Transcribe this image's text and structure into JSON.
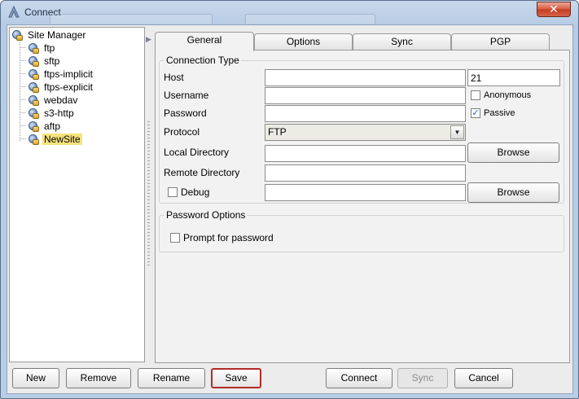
{
  "window": {
    "title": "Connect",
    "close_label": "✕"
  },
  "tree": {
    "root_label": "Site Manager",
    "items": [
      {
        "label": "ftp",
        "selected": false
      },
      {
        "label": "sftp",
        "selected": false
      },
      {
        "label": "ftps-implicit",
        "selected": false
      },
      {
        "label": "ftps-explicit",
        "selected": false
      },
      {
        "label": "webdav",
        "selected": false
      },
      {
        "label": "s3-http",
        "selected": false
      },
      {
        "label": "aftp",
        "selected": false
      },
      {
        "label": "NewSite",
        "selected": true
      }
    ]
  },
  "tabs": {
    "general": "General",
    "options": "Options",
    "sync": "Sync",
    "pgp": "PGP",
    "active": "General"
  },
  "connection": {
    "group_label": "Connection Type",
    "host_label": "Host",
    "host_value": "",
    "port_value": "21",
    "username_label": "Username",
    "username_value": "",
    "anonymous_label": "Anonymous",
    "anonymous_checked": false,
    "password_label": "Password",
    "password_value": "",
    "passive_label": "Passive",
    "passive_checked": true,
    "protocol_label": "Protocol",
    "protocol_value": "FTP",
    "local_dir_label": "Local Directory",
    "local_dir_value": "",
    "local_browse_label": "Browse",
    "remote_dir_label": "Remote Directory",
    "remote_dir_value": "",
    "debug_label": "Debug",
    "debug_checked": false,
    "debug_value": "",
    "debug_browse_label": "Browse"
  },
  "password_options": {
    "group_label": "Password Options",
    "prompt_label": "Prompt for password",
    "prompt_checked": false
  },
  "buttons": {
    "new": "New",
    "remove": "Remove",
    "rename": "Rename",
    "save": "Save",
    "connect": "Connect",
    "sync": "Sync",
    "cancel": "Cancel"
  },
  "colors": {
    "selection": "#f6e37c",
    "focus_border": "#b42a2a",
    "close_button": "#c53b1f"
  }
}
